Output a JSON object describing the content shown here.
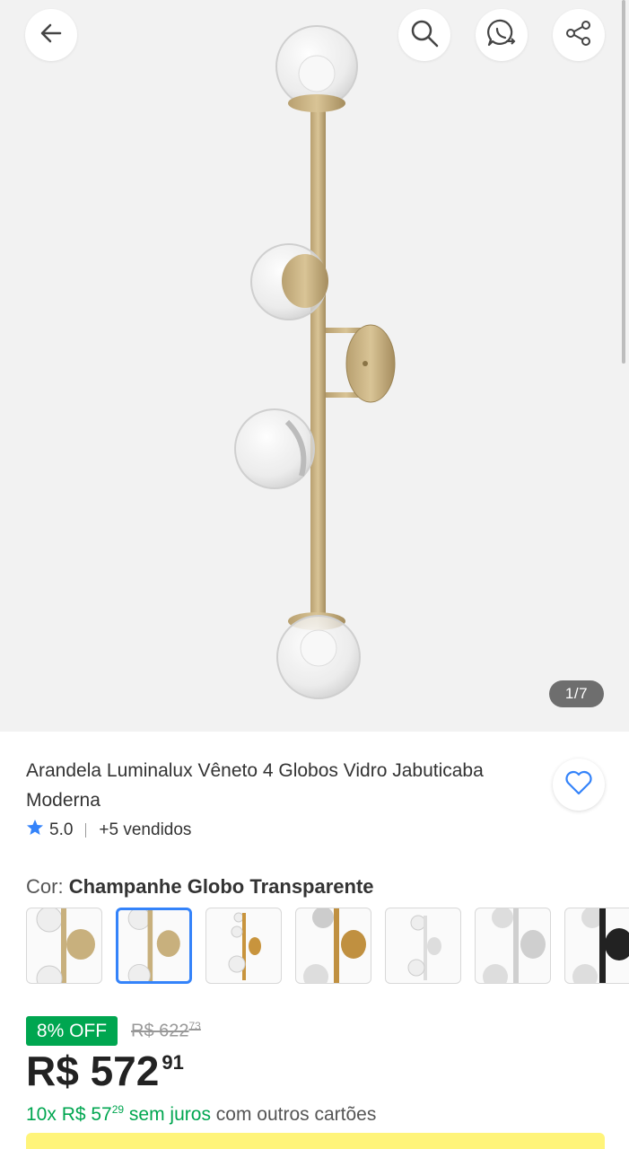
{
  "gallery": {
    "counter": "1/7",
    "icons": [
      "arrow-left-icon",
      "search-icon",
      "whatsapp-icon",
      "share-icon"
    ]
  },
  "product": {
    "title": "Arandela Luminalux Vêneto 4 Globos Vidro Jabuticaba Moderna",
    "rating": "5.0",
    "sold": "+5 vendidos",
    "color_label": "Cor: ",
    "color_value": "Champanhe Globo Transparente",
    "variants_count": 7,
    "selected_variant": 1
  },
  "pricing": {
    "discount": "8% OFF",
    "old_price": "R$ 622",
    "old_cents": "73",
    "price": "R$ 572",
    "price_cents": "91",
    "installments_prefix": "10x R$ 57",
    "installments_cents": "29",
    "installments_green_suffix": " sem juros",
    "installments_suffix": " com outros cartões"
  },
  "colors": {
    "accent_blue": "#3483fa",
    "discount_green": "#00a650",
    "counter_bg": "#6e6e6e",
    "bottom_yellow": "#fff159"
  }
}
